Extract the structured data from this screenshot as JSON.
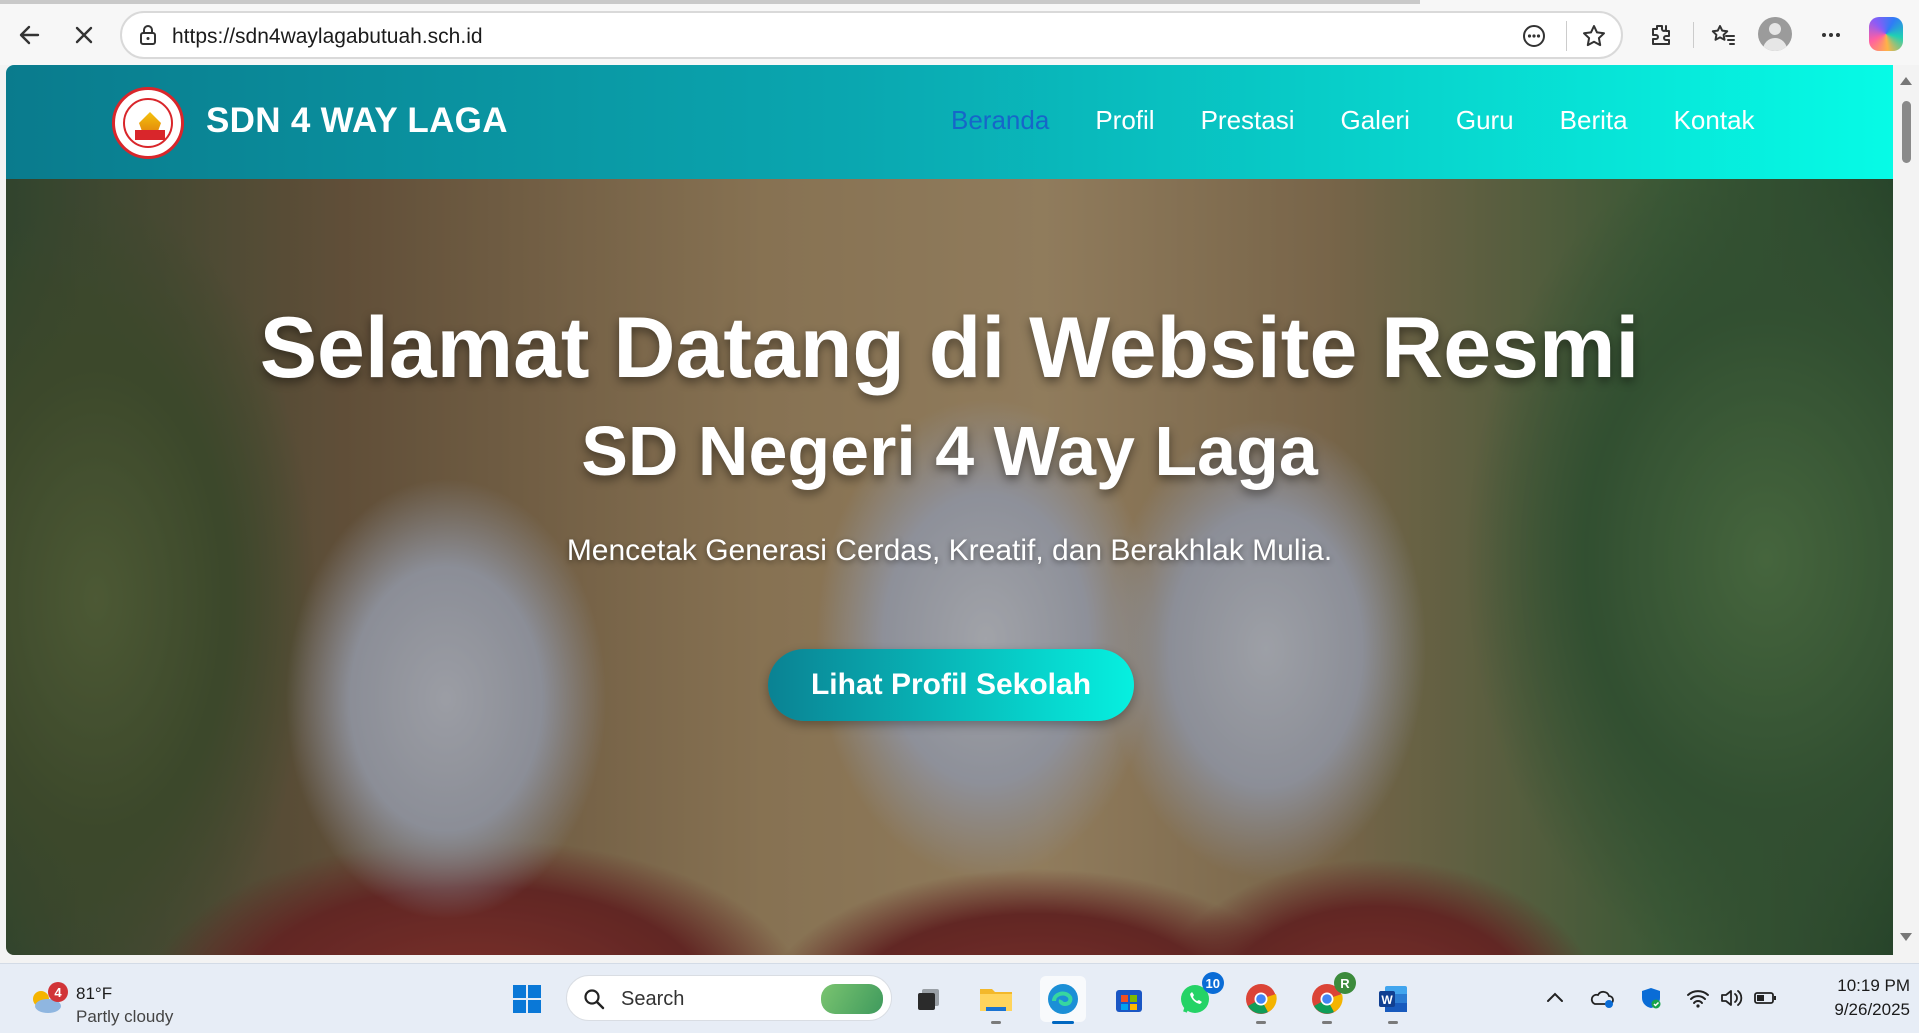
{
  "browser": {
    "url": "https://sdn4waylagabutuah.sch.id",
    "icons": [
      "back-arrow-icon",
      "stop-loading-icon",
      "lock-icon",
      "reading-mode-icon",
      "favorite-star-icon",
      "extensions-icon",
      "favorites-icon",
      "profile-avatar-icon",
      "more-menu-icon",
      "copilot-icon"
    ]
  },
  "site": {
    "title": "SDN 4 WAY LAGA",
    "nav": [
      "Beranda",
      "Profil",
      "Prestasi",
      "Galeri",
      "Guru",
      "Berita",
      "Kontak"
    ],
    "active_nav": "Beranda",
    "hero": {
      "title": "Selamat Datang di Website Resmi",
      "subtitle": "SD Negeri 4 Way Laga",
      "tagline": "Mencetak Generasi Cerdas, Kreatif, dan Berakhlak Mulia.",
      "cta": "Lihat Profil Sekolah"
    },
    "colors": {
      "header_start": "#0a7b8d",
      "header_end": "#06fbe6",
      "nav_active": "#1666c9",
      "text": "#ffffff"
    }
  },
  "taskbar": {
    "weather": {
      "badge": "4",
      "temp": "81°F",
      "condition": "Partly cloudy"
    },
    "search_placeholder": "Search",
    "apps": [
      {
        "name": "start",
        "badge": ""
      },
      {
        "name": "task-view",
        "badge": ""
      },
      {
        "name": "file-explorer",
        "badge": ""
      },
      {
        "name": "edge",
        "badge": ""
      },
      {
        "name": "microsoft-store",
        "badge": ""
      },
      {
        "name": "whatsapp",
        "badge": "10"
      },
      {
        "name": "chrome",
        "badge": ""
      },
      {
        "name": "chrome-profile",
        "badge": "R"
      },
      {
        "name": "word",
        "badge": ""
      }
    ],
    "clock": {
      "time": "10:19 PM",
      "date": "9/26/2025"
    }
  }
}
